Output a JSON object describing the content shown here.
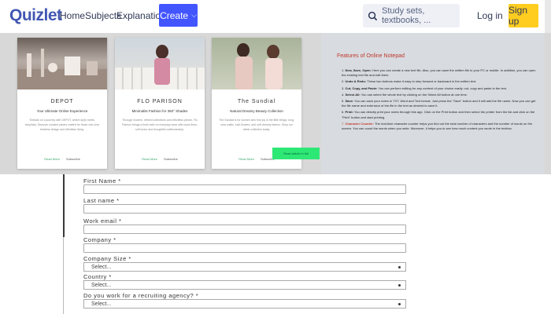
{
  "nav": {
    "logo": "Quizlet",
    "links": [
      "Home",
      "Subjects",
      "Explanations"
    ],
    "create_label": "Create",
    "search_placeholder": "Study sets, textbooks, ...",
    "login_label": "Log in",
    "signup_label": "Sign up"
  },
  "cards": [
    {
      "title": "DEPOT",
      "subtitle": "Your Ultimate Online Experience",
      "desc": "Embark on a journey with DEPOT, where style meets simplicity. Discover curated pieces crafted for those who love timeless design and effortless living.",
      "link1": "Read More",
      "link2": "Subscribe"
    },
    {
      "title": "FLO PARISON",
      "subtitle": "Minimalist Fashion for 360° Shades",
      "desc": "Through modern, refined collections and effortless pieces, Flo Parison brings a fresh take on everyday wear with clean lines, soft tones and thoughtful craftsmanship.",
      "link1": "Read More",
      "link2": "Subscribe"
    },
    {
      "title": "The Sundial",
      "subtitle": "Natural Dreamy Beauty Collection",
      "desc": "The Sundial is for women who find joy in the little things: long, slow walks, lush flowers, and soft dreamy fabrics. Shop our latest collection today.",
      "link1": "Read More",
      "link2": "Subscribe"
    }
  ],
  "tooltip": "Read article in full",
  "notepad": {
    "title": "Features of Online Notepad",
    "items": [
      {
        "num": "1.",
        "bold": "New, Save, Open:",
        "text": " Here you can create a new text file. Also, you can save the written file to your PC or mobile. In addition, you can open the existing text file and edit them."
      },
      {
        "num": "2.",
        "bold": "Undo & Redo:",
        "text": " These two buttons make it easy to step forward or backward in the written text."
      },
      {
        "num": "3.",
        "bold": "Cut, Copy, and Paste:",
        "text": " You can perform editing for any content of your choice easily: cut, copy and paste in the text."
      },
      {
        "num": "4.",
        "bold": "Select All:",
        "text": " You can select the whole text by clicking on the Select All button at one time."
      },
      {
        "num": "5.",
        "bold": "Save:",
        "text": " You can save your notes in TXT, Word and Text format. Just press the \"Save\" button and it will add the file name. Now you can get the file name and extension of the file in the text as desired to save it."
      },
      {
        "num": "6.",
        "bold": "Print:",
        "text": " You can directly print your notes through this app. Click on the Print button and then select the printer from the list and click on the \"Print\" button and start printing."
      },
      {
        "num": "7.",
        "bold": "Character Counter:",
        "text": " The real-time character counter helps you find out the total number of characters and the number of words on the screen. You can count the words when you write. Moreover, it helps you to see how much content you wrote in the textbox."
      }
    ]
  },
  "form": {
    "first_name": "First Name *",
    "last_name": "Last name *",
    "work_email": "Work email *",
    "company": "Company *",
    "company_size": "Company Size *",
    "company_size_value": "Select...",
    "country": "Country *",
    "country_value": "Select...",
    "recruiting": "Do you work for a recruiting agency? *",
    "recruiting_value": "Select..."
  },
  "colors": {
    "brand": "#4257b2",
    "create": "#4255ff",
    "signup": "#ffcd1f",
    "notepad_title": "#c0392b",
    "tooltip": "#2ee876"
  }
}
